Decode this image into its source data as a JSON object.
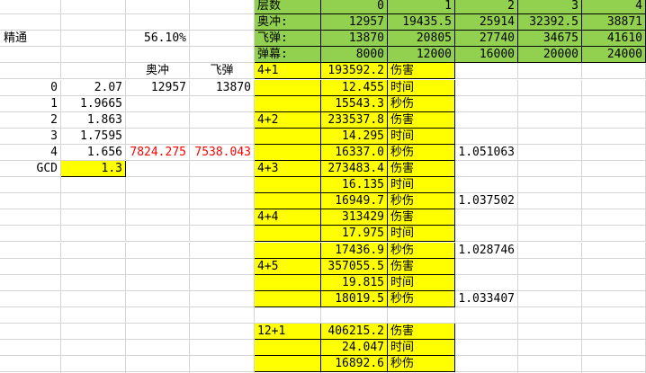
{
  "params": {
    "label": "精通",
    "value": "56.10%"
  },
  "skills": {
    "h1": "奥冲",
    "h2": "飞弹"
  },
  "left_rows": [
    {
      "idx": "0",
      "val": "2.07",
      "a": "12957",
      "b": "13870"
    },
    {
      "idx": "1",
      "val": "1.9665"
    },
    {
      "idx": "2",
      "val": "1.863"
    },
    {
      "idx": "3",
      "val": "1.7595"
    },
    {
      "idx": "4",
      "val": "1.656",
      "a": "7824.275",
      "b": "7538.043"
    }
  ],
  "gcd": {
    "label": "GCD",
    "value": "1.3"
  },
  "top_table": {
    "rows": [
      [
        "层数",
        "0",
        "1",
        "2",
        "3",
        "4"
      ],
      [
        "奥冲:",
        "12957",
        "19435.5",
        "25914",
        "32392.5",
        "38871"
      ],
      [
        "飞弹:",
        "13870",
        "20805",
        "27740",
        "34675",
        "41610"
      ],
      [
        "弹幕:",
        "8000",
        "12000",
        "16000",
        "20000",
        "24000"
      ]
    ]
  },
  "groups": [
    {
      "label": "4+1",
      "dmg": "193592.2",
      "time": "12.455",
      "dps": "15543.3",
      "ratio": ""
    },
    {
      "label": "4+2",
      "dmg": "233537.8",
      "time": "14.295",
      "dps": "16337.0",
      "ratio": "1.051063"
    },
    {
      "label": "4+3",
      "dmg": "273483.4",
      "time": "16.135",
      "dps": "16949.7",
      "ratio": "1.037502"
    },
    {
      "label": "4+4",
      "dmg": "313429",
      "time": "17.975",
      "dps": "17436.9",
      "ratio": "1.028746"
    },
    {
      "label": "4+5",
      "dmg": "357055.5",
      "time": "19.815",
      "dps": "18019.5",
      "ratio": "1.033407"
    },
    {
      "label": "12+1",
      "dmg": "406215.2",
      "time": "24.047",
      "dps": "16892.6",
      "ratio": ""
    }
  ],
  "units": {
    "dmg": "伤害",
    "time": "时间",
    "dps": "秒伤"
  }
}
